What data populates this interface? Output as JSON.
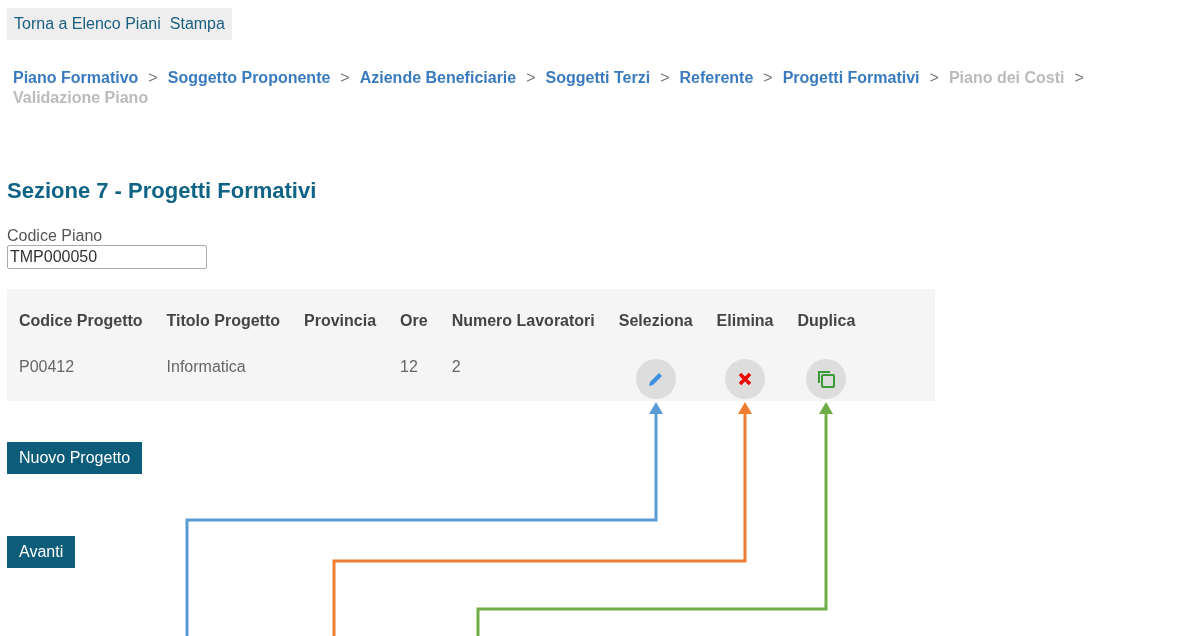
{
  "top_links": [
    "Torna a Elenco Piani",
    "Stampa"
  ],
  "breadcrumb": [
    {
      "label": "Piano Formativo",
      "disabled": false
    },
    {
      "label": "Soggetto Proponente",
      "disabled": false
    },
    {
      "label": "Aziende Beneficiarie",
      "disabled": false
    },
    {
      "label": "Soggetti Terzi",
      "disabled": false
    },
    {
      "label": "Referente",
      "disabled": false
    },
    {
      "label": "Progetti Formativi",
      "disabled": false
    },
    {
      "label": "Piano dei Costi",
      "disabled": true
    },
    {
      "label": "Validazione Piano",
      "disabled": true
    }
  ],
  "breadcrumb_separator": ">",
  "heading": "Sezione 7 - Progetti Formativi",
  "codice_piano": {
    "label": "Codice Piano",
    "value": "TMP000050"
  },
  "table": {
    "columns": [
      "Codice Progetto",
      "Titolo Progetto",
      "Provincia",
      "Ore",
      "Numero Lavoratori",
      "Seleziona",
      "Elimina",
      "Duplica"
    ],
    "rows": [
      {
        "codice": "P00412",
        "titolo": "Informatica",
        "ore": "12",
        "lavoratori": "2"
      }
    ]
  },
  "buttons": [
    "Nuovo Progetto",
    "Avanti"
  ],
  "annotations": [
    {
      "color": "#5b9bd5"
    },
    {
      "color": "#ed7d31"
    },
    {
      "color": "#70ad47"
    }
  ]
}
